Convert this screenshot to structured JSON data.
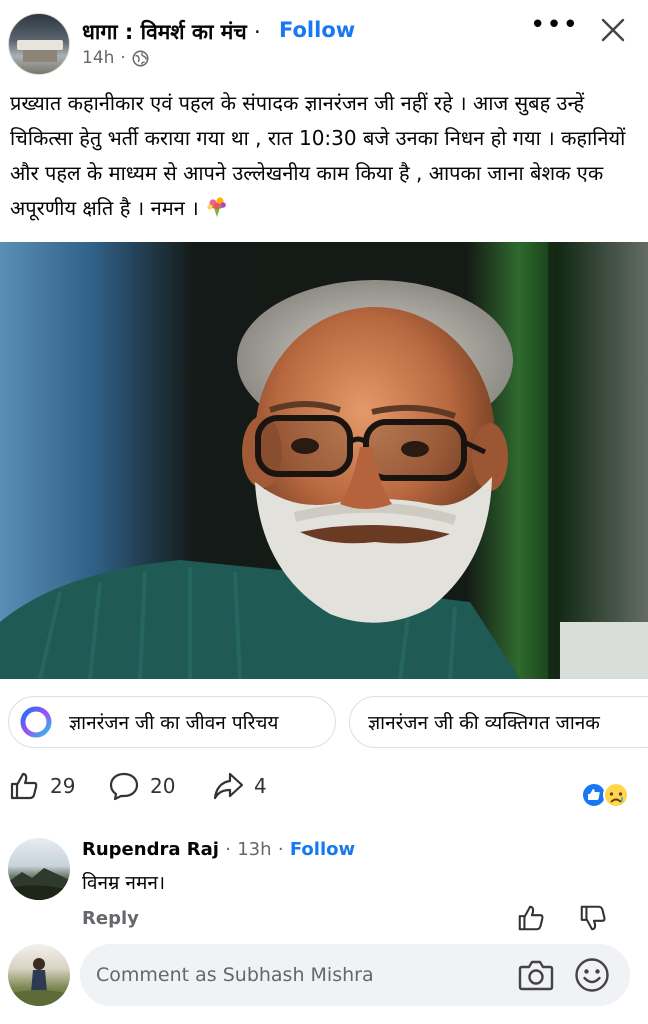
{
  "header": {
    "group_name": "धागा : विमर्श का मंच",
    "separator": "·",
    "follow_label": "Follow",
    "time": "14h",
    "audience_icon": "globe-icon",
    "more_icon": "more-icon",
    "close_icon": "close-icon"
  },
  "post": {
    "text": "प्रख्यात कहानीकार एवं पहल के संपादक ज्ञानरंजन जी नहीं रहे । आज सुबह उन्हें चिकित्सा हेतु भर्ती कराया गया था , रात 10:30 बजे उनका निधन हो गया । कहानियों और पहल के माध्यम से आपने उल्लेखनीय काम किया है , आपका जाना बेशक एक अपूरणीय क्षति है । नमन ।",
    "emoji_icon": "bouquet-icon"
  },
  "suggestions": [
    {
      "label": "ज्ञानरंजन जी का जीवन परिचय",
      "icon": "meta-ai-icon"
    },
    {
      "label": "ज्ञानरंजन जी की व्यक्तिगत जानक"
    }
  ],
  "stats": {
    "likes": "29",
    "comments": "20",
    "shares": "4",
    "reactions": [
      "like",
      "sad"
    ]
  },
  "comment": {
    "author": "Rupendra Raj",
    "separator": "·",
    "time": "13h",
    "follow_label": "Follow",
    "text": "विनम्र नमन।",
    "reply_label": "Reply"
  },
  "composer": {
    "placeholder": "Comment as Subhash Mishra",
    "camera_icon": "camera-icon",
    "emoji_icon": "emoji-icon"
  },
  "colors": {
    "accent": "#1877f2",
    "secondary_text": "#65676b",
    "composer_bg": "#f0f2f5"
  }
}
